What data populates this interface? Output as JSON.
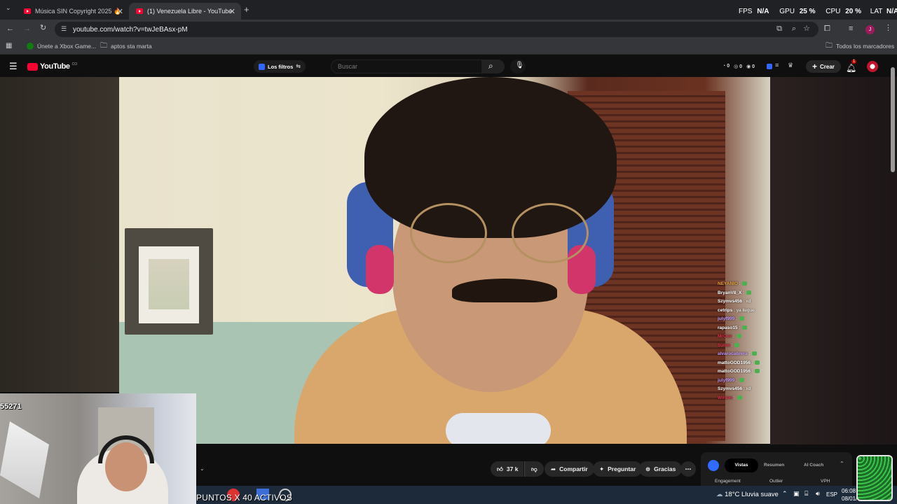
{
  "browser": {
    "tabs": [
      {
        "title": "Música SIN Copyright 2025 🔥",
        "active": false
      },
      {
        "title": "(1) Venezuela Libre - YouTube",
        "active": true
      }
    ],
    "url": "youtube.com/watch?v=twJeBAsx-pM",
    "bookmarks": [
      {
        "label": "Únete a Xbox Game..."
      },
      {
        "label": "aptos sta marta"
      }
    ],
    "all_bookmarks": "Todos los marcadores",
    "profile_initial": "J"
  },
  "overlay_stats": {
    "fps_label": "FPS",
    "fps_value": "N/A",
    "gpu_label": "GPU",
    "gpu_value": "25 %",
    "cpu_label": "CPU",
    "cpu_value": "20 %",
    "lat_label": "LAT",
    "lat_value": "N/A"
  },
  "youtube": {
    "logo": "YouTube",
    "logo_country": "CO",
    "filters_label": "Los filtros",
    "search_placeholder": "Buscar",
    "header_counts": [
      "0",
      "0",
      "0"
    ],
    "create_label": "Crear",
    "notification_count": "1"
  },
  "chat": [
    {
      "user": "NEYANIO",
      "msg": "",
      "color": "#e8a13a"
    },
    {
      "user": "BryanV8_X",
      "msg": "",
      "color": "#ffffff"
    },
    {
      "user": "Szymvs456",
      "msg": "xd",
      "color": "#ffffff"
    },
    {
      "user": "cetrips",
      "msg": "ya llegue",
      "color": "#ffffff"
    },
    {
      "user": "julyf999",
      "msg": "",
      "color": "#c49bff"
    },
    {
      "user": "rapaso15",
      "msg": "",
      "color": "#ffffff"
    },
    {
      "user": "MrCue",
      "msg": "",
      "color": "#e0324a"
    },
    {
      "user": "Sume",
      "msg": "",
      "color": "#e0324a"
    },
    {
      "user": "alvarocabrera",
      "msg": "",
      "color": "#c49bff"
    },
    {
      "user": "mattoGOD1956",
      "msg": "",
      "color": "#ffffff"
    },
    {
      "user": "mattoGOD1956",
      "msg": "",
      "color": "#ffffff"
    },
    {
      "user": "julyf999",
      "msg": "",
      "color": "#c49bff"
    },
    {
      "user": "Szymvs456",
      "msg": "xd",
      "color": "#ffffff"
    },
    {
      "user": "Wilson",
      "msg": "",
      "color": "#e0324a"
    }
  ],
  "cam_overlay_text": "55271",
  "actions": {
    "likes": "37 k",
    "share": "Compartir",
    "ask": "Preguntar",
    "thanks": "Gracias"
  },
  "side_panel": {
    "tabs": [
      "Vistas",
      "Resumen",
      "AI Coach"
    ],
    "active_tab": "Vistas",
    "columns": [
      "Engagement",
      "Outlier",
      "VPH"
    ]
  },
  "stream_banner": "PUNTOS X 40 ACTIVOS",
  "taskbar": {
    "weather": "18°C  Lluvia suave",
    "lang": "ESP",
    "time": "06:08",
    "date": "08/01/"
  }
}
